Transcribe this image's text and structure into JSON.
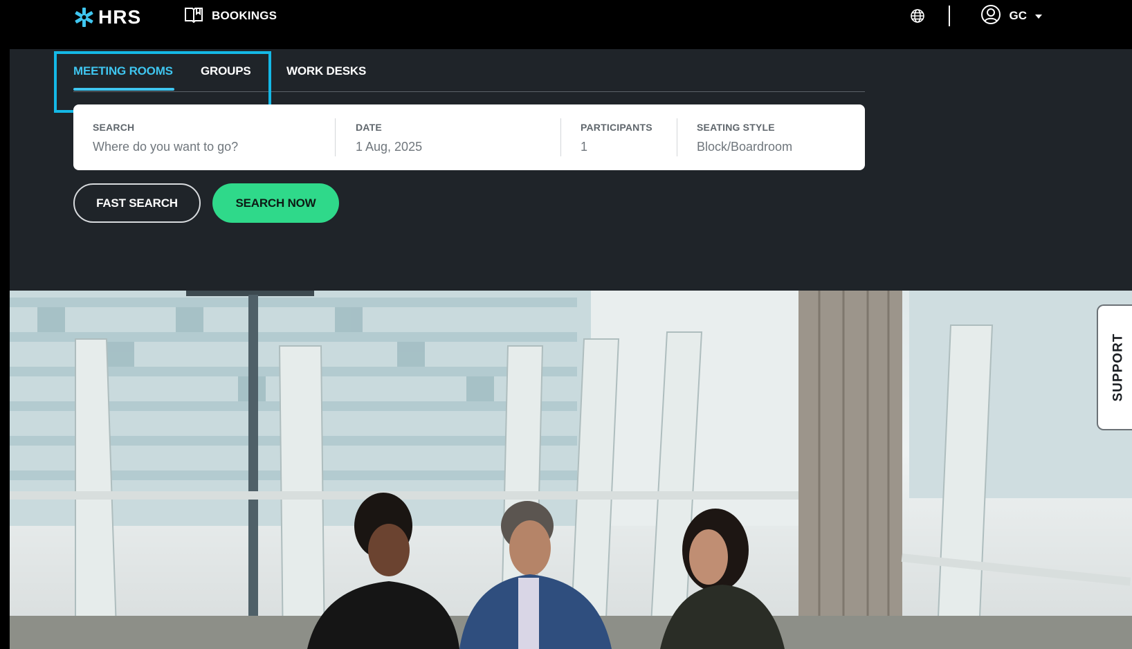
{
  "brand": {
    "name": "HRS",
    "accent_color": "#3fc6f0",
    "logo_icon": "hrs-star-logo-icon"
  },
  "topnav": {
    "bookings_label": "BOOKINGS",
    "bookings_icon": "book-icon",
    "language_icon": "globe-icon",
    "user_icon": "user-circle-icon",
    "user_initials": "GC",
    "user_menu_icon": "caret-down-icon"
  },
  "tabs": [
    {
      "label": "MEETING ROOMS",
      "active": true
    },
    {
      "label": "GROUPS",
      "active": false
    },
    {
      "label": "WORK DESKS",
      "active": false
    }
  ],
  "search_form": {
    "search": {
      "label": "SEARCH",
      "placeholder": "Where do you want to go?"
    },
    "date": {
      "label": "DATE",
      "value": "1 Aug, 2025"
    },
    "participants": {
      "label": "PARTICIPANTS",
      "value": "1"
    },
    "seating_style": {
      "label": "SEATING STYLE",
      "value": "Block/Boardroom"
    }
  },
  "buttons": {
    "fast_search": "FAST SEARCH",
    "search_now": "SEARCH NOW",
    "search_now_color": "#2fd98a"
  },
  "support_tab": {
    "label": "SUPPORT"
  },
  "highlight_color": "#14b8e6"
}
